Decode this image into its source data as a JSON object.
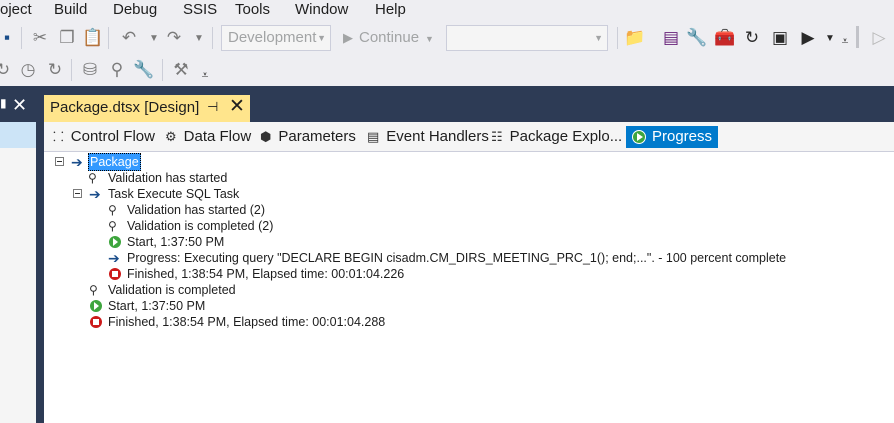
{
  "menu": {
    "items": [
      "oject",
      "Build",
      "Debug",
      "SSIS",
      "Tools",
      "Window",
      "Help"
    ]
  },
  "toolbar": {
    "configuration": "Development",
    "continue_label": "Continue",
    "platform": ""
  },
  "document_tab": {
    "title": "Package.dtsx [Design]"
  },
  "designer_tabs": [
    {
      "label": "Control Flow",
      "icon": "control-flow-icon"
    },
    {
      "label": "Data Flow",
      "icon": "data-flow-icon"
    },
    {
      "label": "Parameters",
      "icon": "parameters-icon"
    },
    {
      "label": "Event Handlers",
      "icon": "event-handlers-icon"
    },
    {
      "label": "Package Explo...",
      "icon": "package-explorer-icon"
    },
    {
      "label": "Progress",
      "icon": "progress-icon",
      "active": true
    }
  ],
  "progress_tree": {
    "root": "Package",
    "lines": [
      "Validation has started",
      "Task Execute SQL Task",
      "Validation has started (2)",
      "Validation is completed (2)",
      "Start, 1:37:50 PM",
      "Progress: Executing query \"DECLARE BEGIN cisadm.CM_DIRS_MEETING_PRC_1(); end;...\". - 100 percent complete",
      "Finished, 1:38:54 PM, Elapsed time: 00:01:04.226",
      "Validation is completed",
      "Start, 1:37:50 PM",
      "Finished, 1:38:54 PM, Elapsed time: 00:01:04.288"
    ]
  },
  "colors": {
    "accent": "#007acc",
    "doc_tab": "#ffe58c",
    "dark_band": "#2d3b55",
    "start_green": "#3ea53e",
    "stop_red": "#cc1a1a"
  }
}
